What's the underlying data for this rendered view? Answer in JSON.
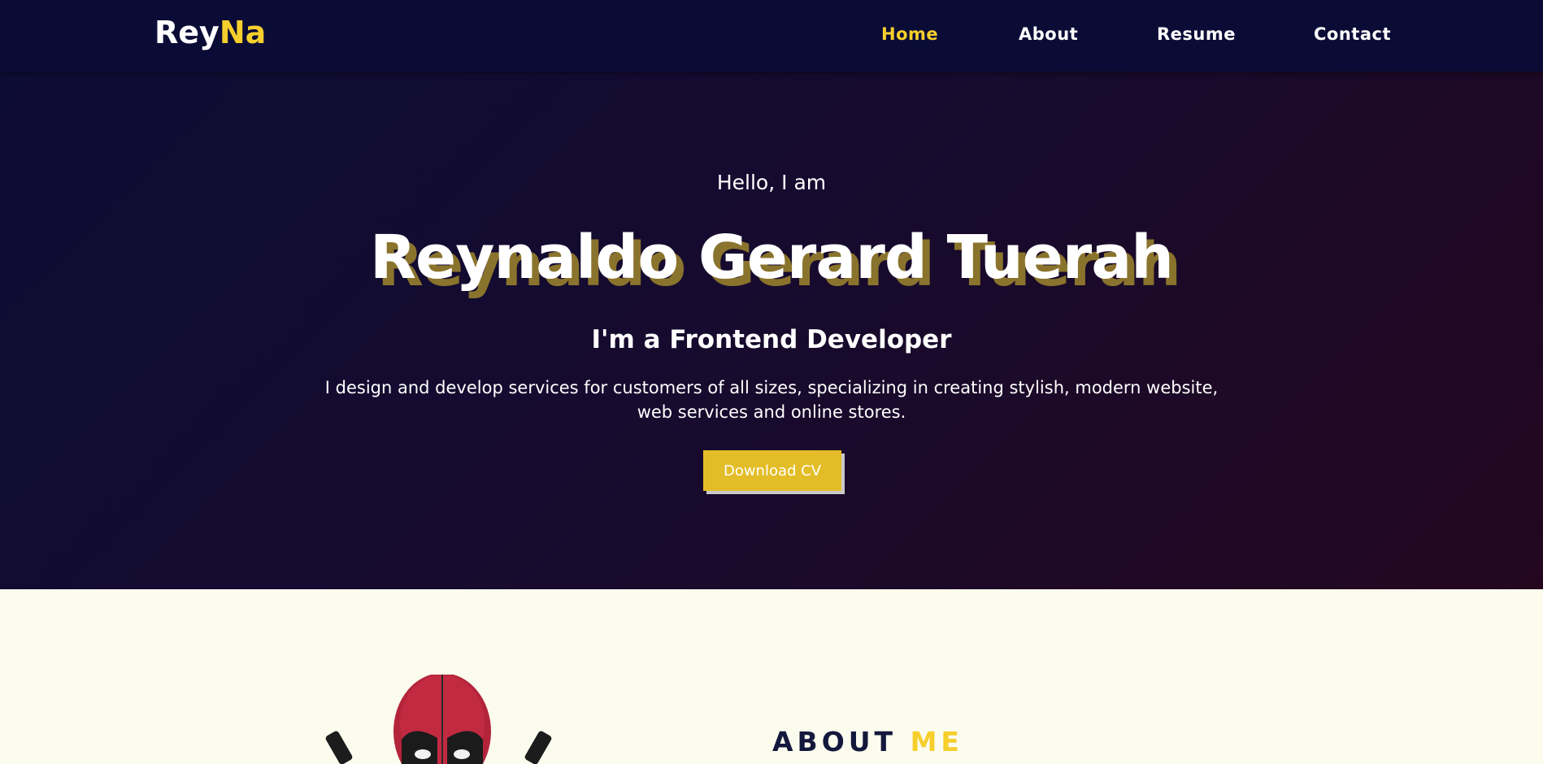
{
  "brand": {
    "first": "Rey",
    "accent": "Na"
  },
  "nav": {
    "home": "Home",
    "about": "About",
    "resume": "Resume",
    "contact": "Contact"
  },
  "hero": {
    "greeting": "Hello, I am",
    "name": "Reynaldo Gerard Tuerah",
    "role": "I'm a Frontend Developer",
    "description": "I design and develop services for customers of all sizes, specializing in creating stylish, modern website, web services and online stores.",
    "cta_label": "Download CV"
  },
  "about": {
    "title_main": "ABOUT",
    "title_accent": "ME"
  },
  "colors": {
    "navbar": "#0b0c36",
    "accent": "#f6cf2c",
    "button": "#e3bd27",
    "about_bg": "#fbfbee",
    "hero_gradient_start": "#0d0c34",
    "hero_gradient_end": "#24071f"
  },
  "icons": [
    "deadpool-avatar-image"
  ]
}
